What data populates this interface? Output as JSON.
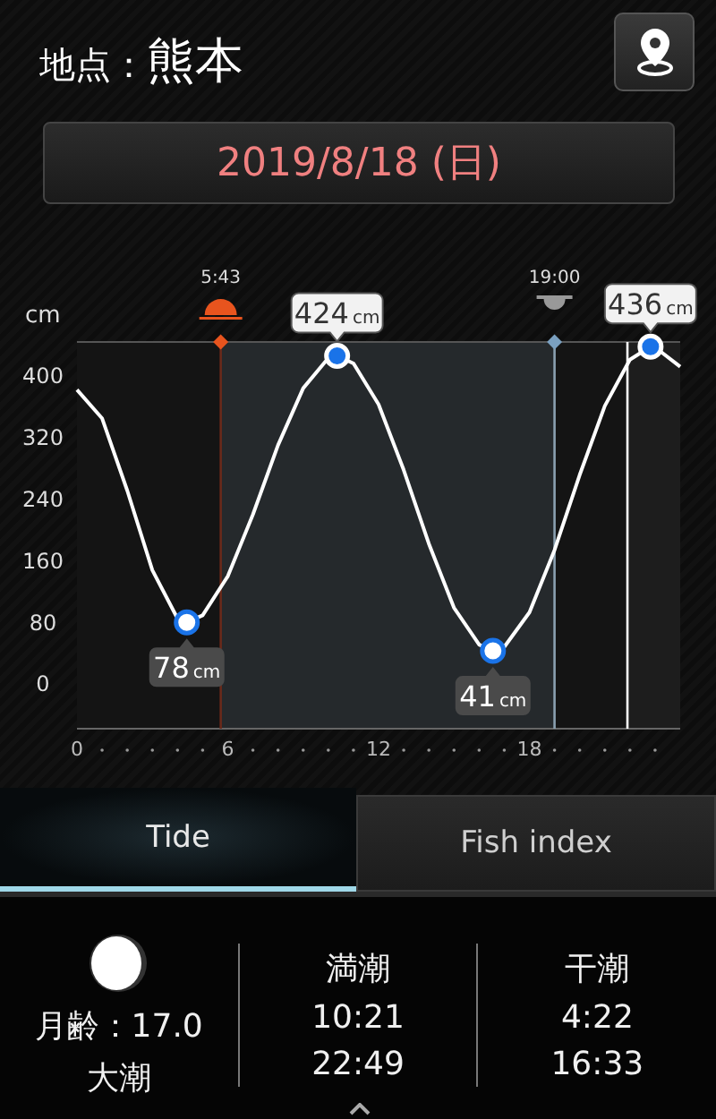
{
  "header": {
    "label": "地点：",
    "place": "熊本"
  },
  "date_button": "2019/8/18 (日)",
  "chart": {
    "sun_times": [
      "5:43",
      "19:00"
    ],
    "callouts": [
      {
        "text": "78",
        "unit": "cm"
      },
      {
        "text": "424",
        "unit": "cm"
      },
      {
        "text": "41",
        "unit": "cm"
      },
      {
        "text": "436",
        "unit": "cm"
      }
    ],
    "chart_data": {
      "type": "line",
      "ylabel": "cm",
      "xlim": [
        0,
        24
      ],
      "ylim": [
        -60,
        442
      ],
      "xticks": [
        0,
        6,
        12,
        18
      ],
      "yticks": [
        0,
        80,
        160,
        240,
        320,
        400
      ],
      "ref_lines": [
        {
          "axis": "x",
          "value": 5.72
        },
        {
          "axis": "x",
          "value": 19
        },
        {
          "axis": "x",
          "value": 21.9
        }
      ],
      "series": [
        {
          "color": "#ffffff",
          "x": [
            0,
            1,
            2,
            3,
            4,
            4.37,
            5,
            6,
            7,
            8,
            9,
            10,
            10.35,
            11,
            12,
            13,
            14,
            15,
            16,
            16.55,
            17,
            18,
            19,
            20,
            21,
            22,
            22.82,
            23,
            24
          ],
          "values": [
            380,
            343,
            249,
            146,
            83,
            78,
            87,
            138,
            218,
            308,
            382,
            421,
            424,
            414,
            361,
            276,
            180,
            97,
            49,
            41,
            46,
            91,
            172,
            269,
            359,
            419,
            436,
            435,
            410
          ]
        }
      ]
    }
  },
  "tabs": [
    {
      "label": "Tide",
      "selected": true
    },
    {
      "label": "Fish index",
      "selected": false
    }
  ],
  "moon": {
    "age": "月齢：17.0",
    "tide_name": "大潮"
  },
  "columns": [
    {
      "title": "満潮",
      "times": [
        "10:21",
        "22:49"
      ]
    },
    {
      "title": "干潮",
      "times": [
        "4:22",
        "16:33"
      ]
    }
  ]
}
